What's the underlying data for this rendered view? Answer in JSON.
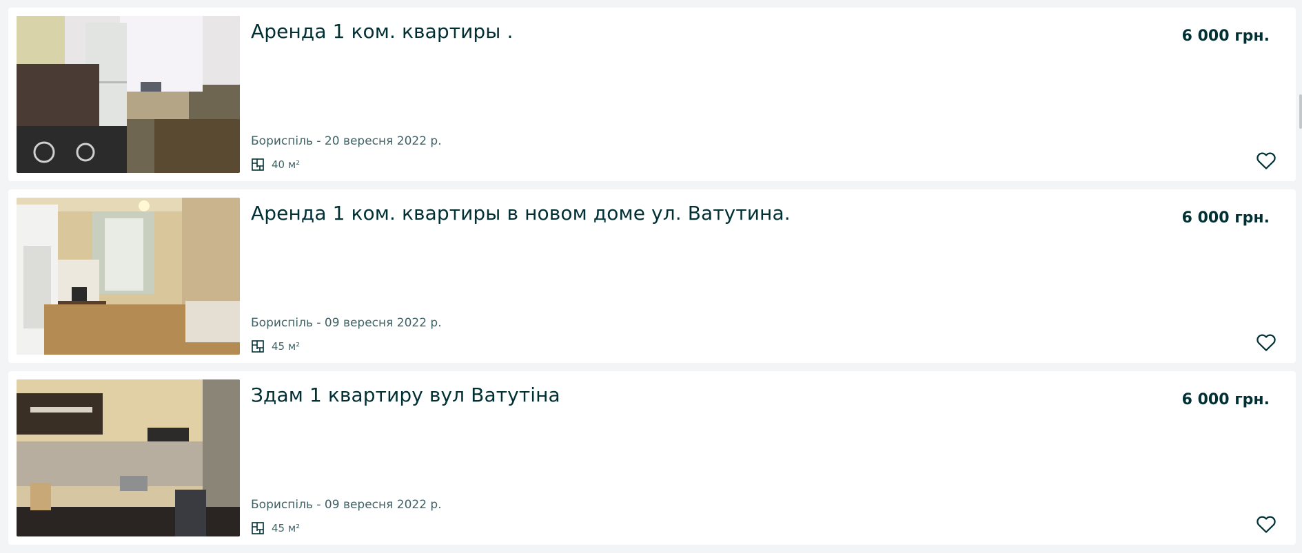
{
  "listings": [
    {
      "title": "Аренда 1 ком. квартиры .",
      "price": "6 000 грн.",
      "location_date": "Бориспіль - 20 вересня 2022 р.",
      "area": "40 м²",
      "photo": "kitchen-with-fridge-and-stove"
    },
    {
      "title": "Аренда 1 ком. квартиры в новом доме ул. Ватутина.",
      "price": "6 000 грн.",
      "location_date": "Бориспіль - 09 вересня 2022 р.",
      "area": "45 м²",
      "photo": "living-room-with-wardrobe"
    },
    {
      "title": "Здам 1 квартиру вул Ватутіна",
      "price": "6 000 грн.",
      "location_date": "Бориспіль - 09 вересня 2022 р.",
      "area": "45 м²",
      "photo": "kitchen-with-cabinets"
    }
  ],
  "icons": {
    "area": "floor-plan-icon",
    "favorite": "heart-outline-icon"
  },
  "colors": {
    "text_primary": "#002f34",
    "text_secondary": "#406367",
    "background": "#f2f4f5",
    "card": "#ffffff"
  }
}
